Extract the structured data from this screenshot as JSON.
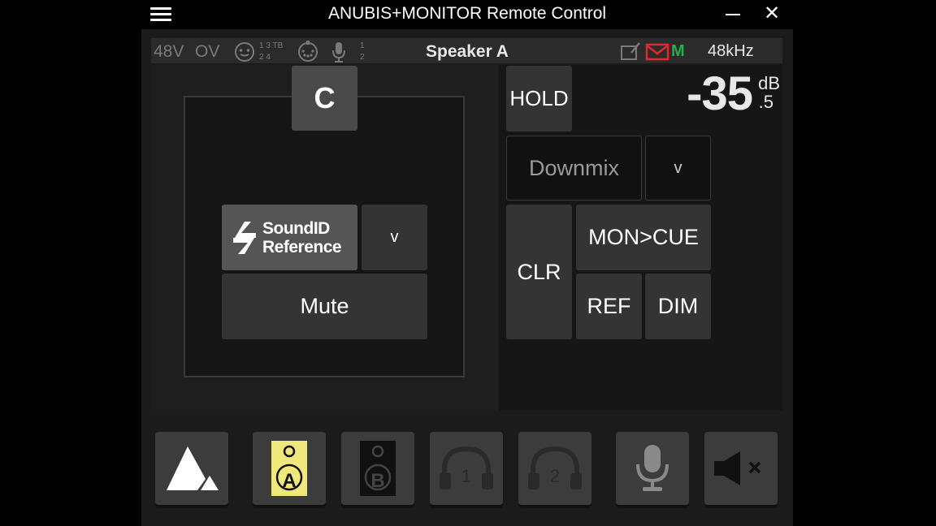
{
  "window": {
    "title": "ANUBIS+MONITOR Remote Control",
    "minimize_symbol": "—",
    "close_symbol": "✕"
  },
  "status": {
    "phantom": "48V",
    "overload": "OV",
    "inputs_row1": "1 3 TB",
    "inputs_row2": "2 4",
    "mic_row1": "1",
    "mic_row2": "2",
    "speaker": "Speaker A",
    "mode_letter": "M",
    "sample_rate": "48kHz",
    "colors": {
      "mode_letter": "#22b14c",
      "mail_icon": "#e0282e"
    }
  },
  "speaker_config": {
    "center_channel": "C",
    "soundid_line1": "SoundID",
    "soundid_line2": "Reference",
    "soundid_dropdown": "v",
    "mute": "Mute"
  },
  "controls": {
    "hold": "HOLD",
    "downmix": "Downmix",
    "downmix_dropdown": "v",
    "clr": "CLR",
    "mon_cue": "MON>CUE",
    "ref": "REF",
    "dim": "DIM"
  },
  "volume": {
    "value": "-35",
    "unit": "dB",
    "fraction": ".5"
  },
  "bottom": {
    "speaker_a_label": "A",
    "speaker_b_label": "B",
    "headphone1_label": "1",
    "headphone2_label": "2",
    "active_color": "#f0e87a"
  }
}
